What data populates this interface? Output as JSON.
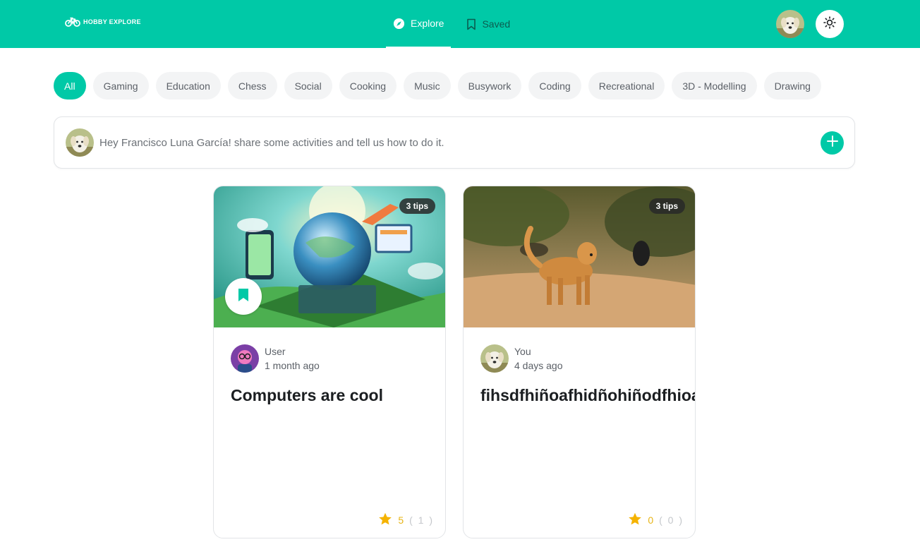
{
  "app": {
    "logo_text": "HOBBY EXPLORE",
    "accent_color": "#00c9a7",
    "star_color": "#f5b301"
  },
  "nav": {
    "tabs": [
      {
        "label": "Explore",
        "icon": "compass-icon",
        "active": true
      },
      {
        "label": "Saved",
        "icon": "bookmark-icon",
        "active": false
      }
    ]
  },
  "header": {
    "avatar": "dog-avatar",
    "theme_toggle_icon": "sun-icon"
  },
  "categories": [
    "All",
    "Gaming",
    "Education",
    "Chess",
    "Social",
    "Cooking",
    "Music",
    "Busywork",
    "Coding",
    "Recreational",
    "3D - Modelling",
    "Drawing"
  ],
  "active_category": "All",
  "composer": {
    "prompt": "Hey Francisco Luna García! share some activities and tell us how to do it.",
    "add_icon": "plus-icon"
  },
  "cards": [
    {
      "tips_badge": "3 tips",
      "image": "technology-globe-illustration",
      "saved": true,
      "author": "User",
      "time": "1 month ago",
      "title": "Computers are cool",
      "rating": "5",
      "rating_count": "( 1 )"
    },
    {
      "tips_badge": "3 tips",
      "image": "golden-dog-on-dirt-road-photo",
      "saved": false,
      "author": "You",
      "time": "4 days ago",
      "title": "fihsdfhiñoafhidñohiñodfhioa",
      "rating": "0",
      "rating_count": "( 0 )"
    }
  ]
}
